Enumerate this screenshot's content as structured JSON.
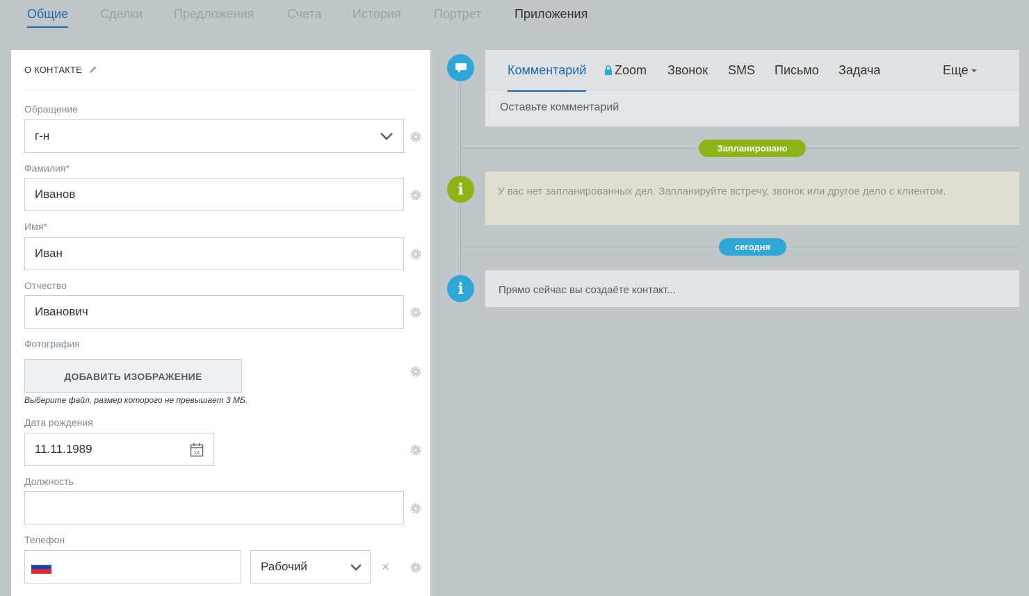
{
  "tabs": [
    {
      "label": "Общие",
      "state": "active"
    },
    {
      "label": "Сделки",
      "state": "normal"
    },
    {
      "label": "Предложения",
      "state": "normal"
    },
    {
      "label": "Счета",
      "state": "normal"
    },
    {
      "label": "История",
      "state": "normal"
    },
    {
      "label": "Портрет",
      "state": "normal"
    },
    {
      "label": "Приложения",
      "state": "emphasized"
    }
  ],
  "contact": {
    "section_title": "О КОНТАКТЕ",
    "salutation": {
      "label": "Обращение",
      "value": "г-н"
    },
    "last_name": {
      "label": "Фамилия*",
      "value": "Иванов"
    },
    "first_name": {
      "label": "Имя*",
      "value": "Иван"
    },
    "middle_name": {
      "label": "Отчество",
      "value": "Иванович"
    },
    "photo": {
      "label": "Фотография",
      "button": "ДОБАВИТЬ ИЗОБРАЖЕНИЕ",
      "hint": "Выберите файл, размер которого не превышает 3 МБ."
    },
    "birthdate": {
      "label": "Дата рождения",
      "value": "11.11.1989",
      "calendar_day": "24"
    },
    "position": {
      "label": "Должность",
      "value": ""
    },
    "phone": {
      "label": "Телефон",
      "value": "",
      "type": "Рабочий",
      "remove": "×"
    }
  },
  "editor": {
    "tabs": [
      {
        "label": "Комментарий",
        "state": "active"
      },
      {
        "label": "Zoom",
        "locked": true
      },
      {
        "label": "Звонок"
      },
      {
        "label": "SMS"
      },
      {
        "label": "Письмо"
      },
      {
        "label": "Задача"
      }
    ],
    "more": "Еще",
    "placeholder": "Оставьте комментарий"
  },
  "timeline": {
    "planned_badge": "Запланировано",
    "planned_text": "У вас нет запланированных дел. Запланируйте встречу, звонок или другое дело с клиентом.",
    "today_badge": "сегодня",
    "today_text": "Прямо сейчас вы создаёте контакт...",
    "info_glyph": "i"
  },
  "colors": {
    "accent": "#2067b0",
    "green": "#8db415",
    "blue": "#2fa6d8",
    "background": "#c1c6c9"
  },
  "icons": [
    "pencil-icon",
    "gear-icon",
    "chevron-down-icon",
    "calendar-icon",
    "russia-flag-icon",
    "close-icon",
    "comment-icon",
    "info-icon",
    "lock-icon",
    "caret-down-icon"
  ]
}
